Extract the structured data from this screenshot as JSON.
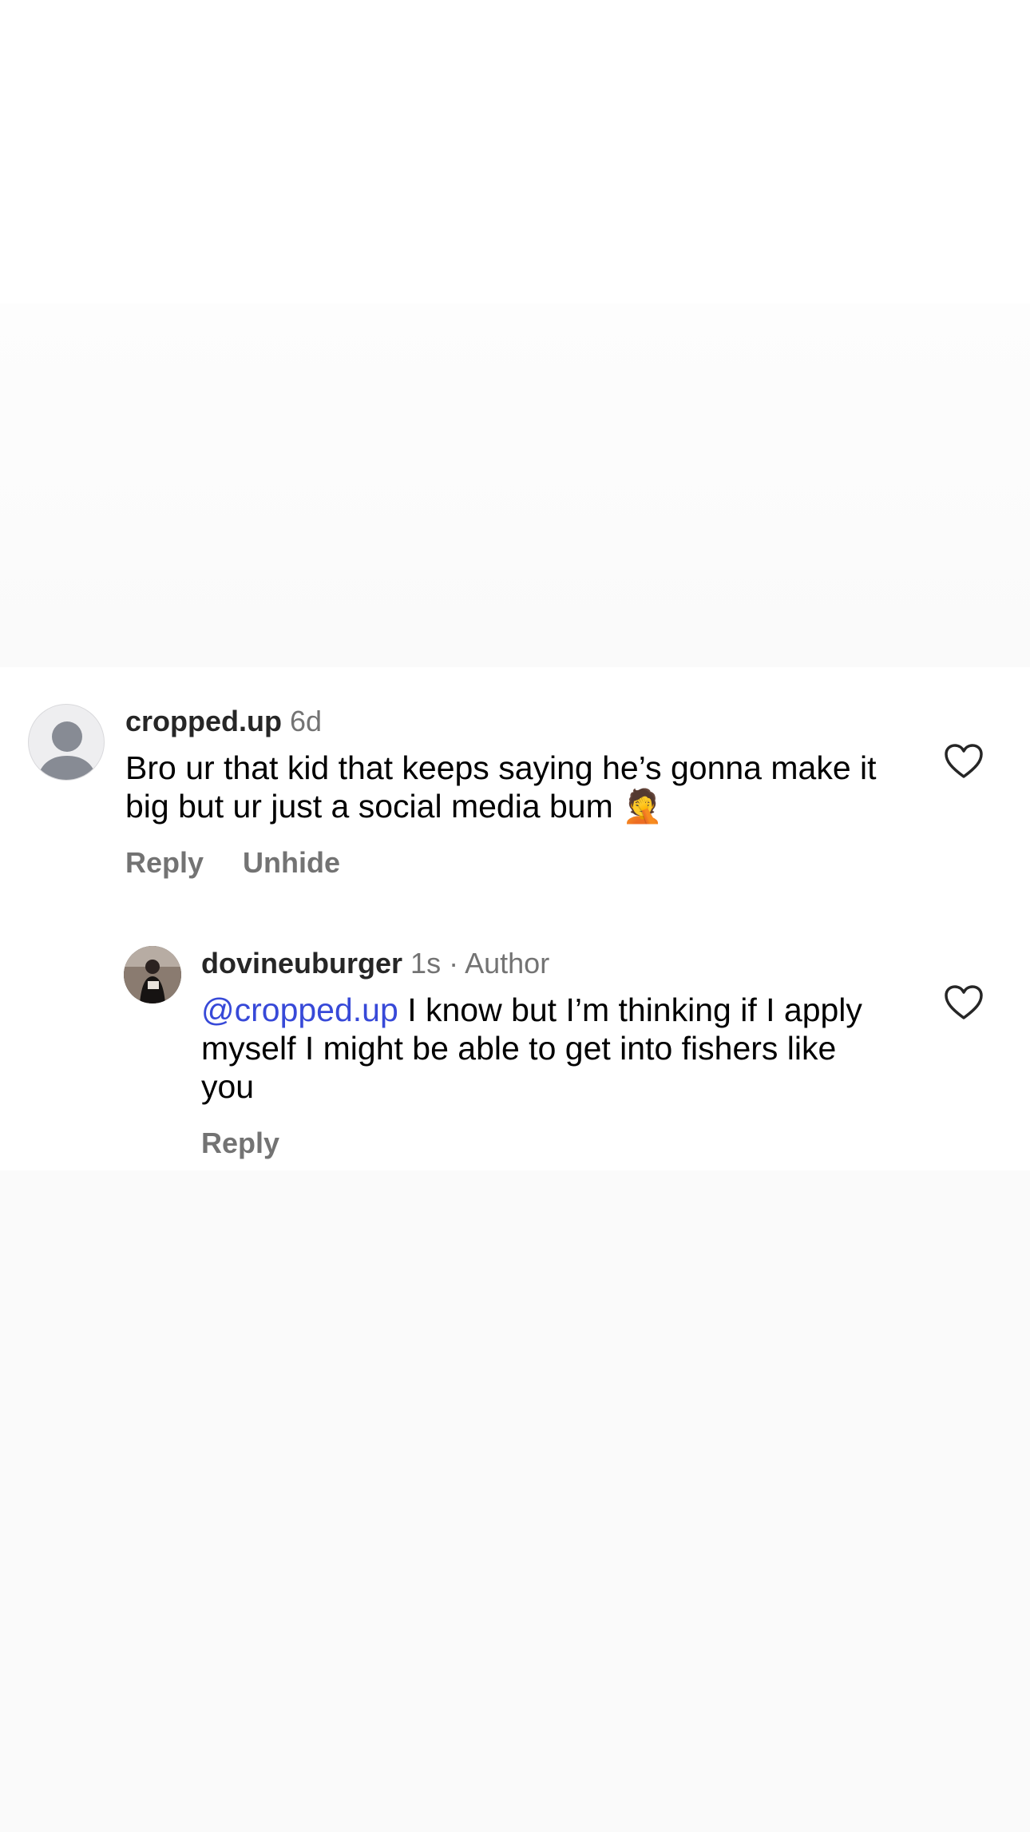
{
  "comments": [
    {
      "username": "cropped.up",
      "timestamp": "6d",
      "text": "Bro ur that kid that keeps saying he’s gonna make it big but ur just a social media bum 🤦",
      "actions": {
        "reply": "Reply",
        "unhide": "Unhide"
      },
      "avatar_icon": "default-user-icon"
    },
    {
      "username": "dovineuburger",
      "timestamp": "1s",
      "separator": "·",
      "author_tag": "Author",
      "mention": "@cropped.up",
      "text": "I know but I’m thinking if I apply myself I might be able to get into fishers like you",
      "actions": {
        "reply": "Reply"
      },
      "avatar_icon": "user-photo"
    }
  ],
  "icons": {
    "like": "heart-outline-icon"
  },
  "colors": {
    "mention": "#3749d8",
    "secondary_text": "#737373",
    "primary_text": "#262626",
    "background": "#fafafa"
  }
}
